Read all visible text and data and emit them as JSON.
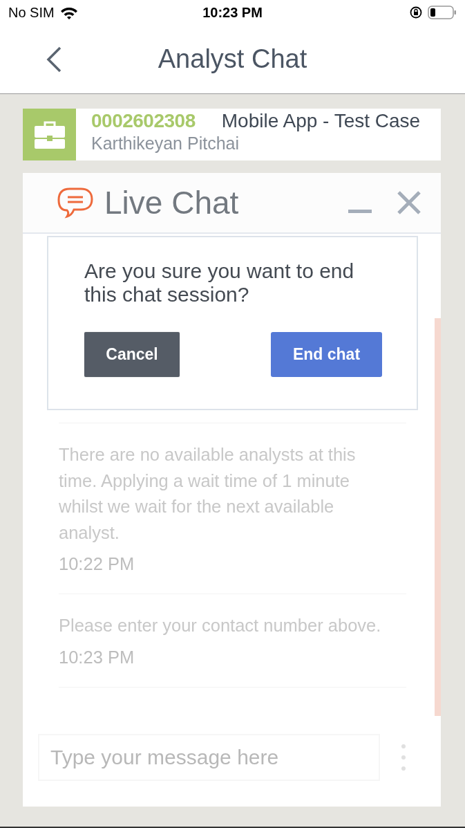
{
  "status_bar": {
    "carrier": "No SIM",
    "time": "10:23 PM"
  },
  "nav": {
    "title": "Analyst Chat"
  },
  "case": {
    "number": "0002602308",
    "title": "Mobile App - Test Case",
    "owner": "Karthikeyan Pitchai"
  },
  "chat": {
    "title": "Live Chat",
    "dialog": {
      "message": "Are you sure you want to end this chat session?",
      "buttons": [
        {
          "label": "Cancel",
          "kind": "secondary"
        },
        {
          "label": "End chat",
          "kind": "primary"
        }
      ]
    },
    "messages": [
      {
        "text": "There are no available analysts at this time. Applying a wait time of 1 minute whilst we wait for the next available analyst.",
        "time": "10:22 PM"
      },
      {
        "text": "Please enter your contact number above.",
        "time": "10:23 PM"
      }
    ],
    "input": {
      "placeholder": "Type your message here"
    }
  }
}
